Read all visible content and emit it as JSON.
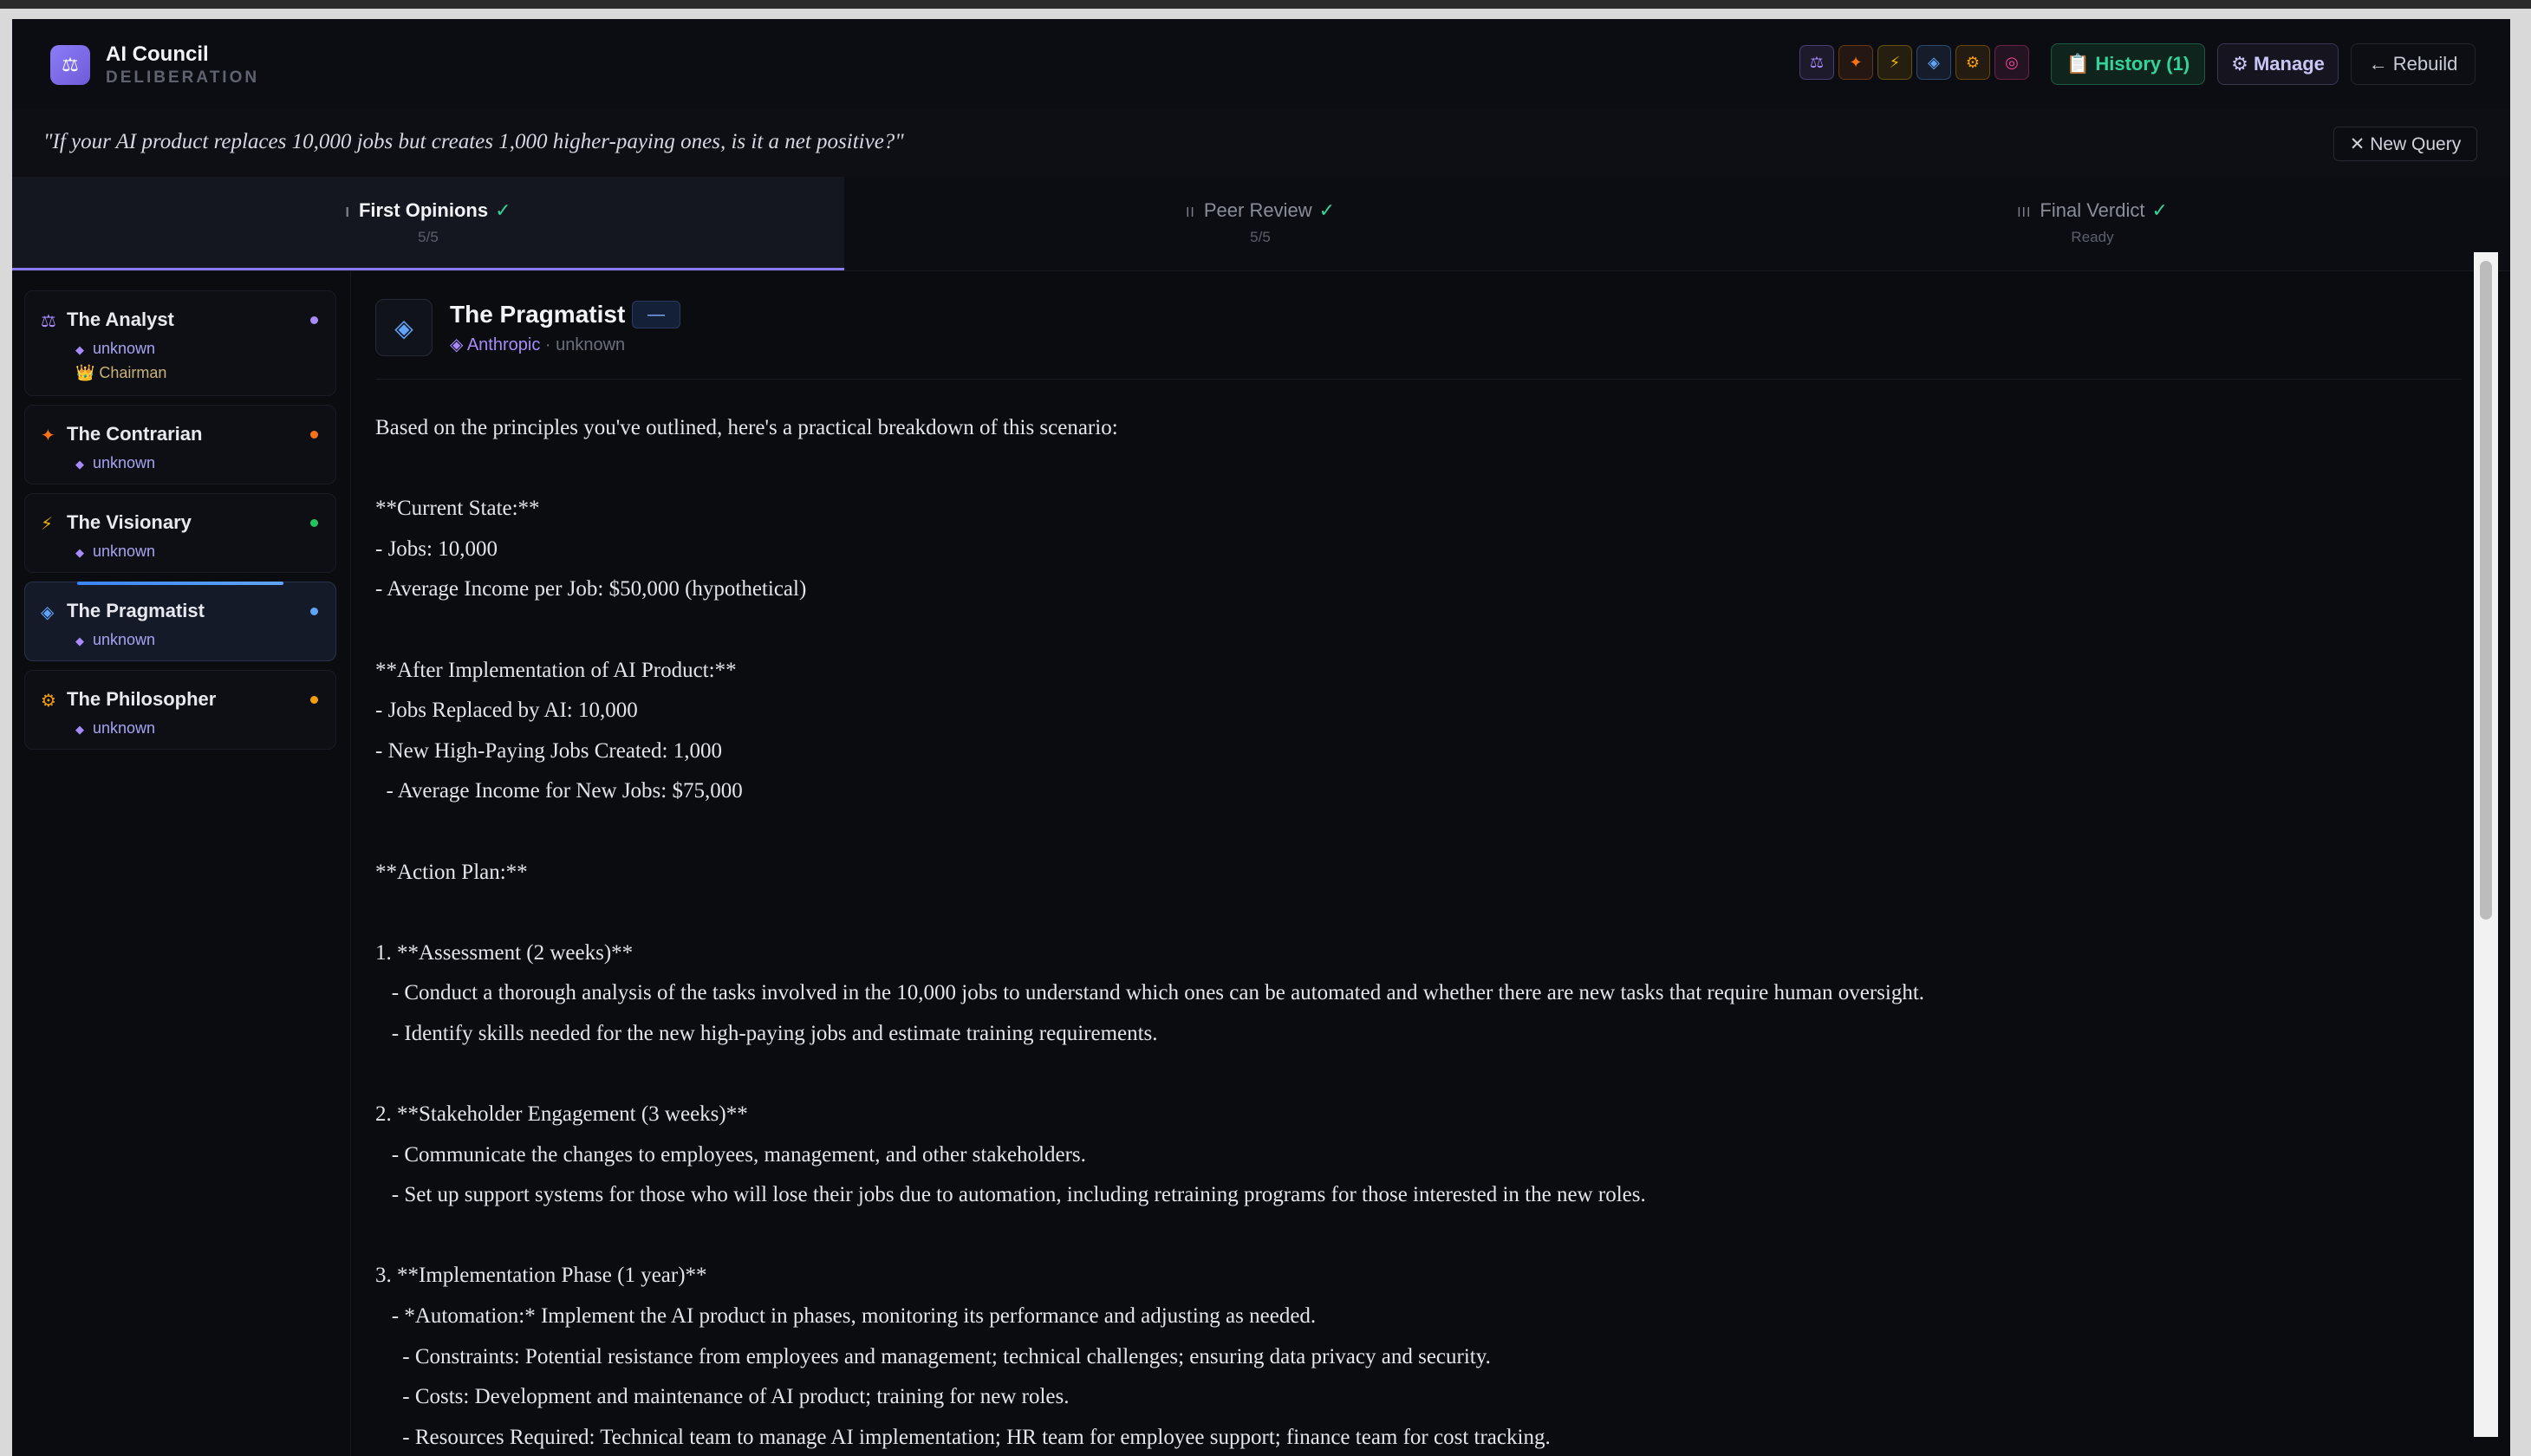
{
  "app": {
    "title": "AI Council",
    "subtitle": "DELIBERATION",
    "logo_icon": "scales-icon"
  },
  "header": {
    "seat_icons": [
      {
        "glyph": "⚖",
        "name": "scales-icon",
        "color": "#a78bfa"
      },
      {
        "glyph": "✦",
        "name": "sparkle-icon",
        "color": "#f97316"
      },
      {
        "glyph": "⚡",
        "name": "bolt-icon",
        "color": "#eab308"
      },
      {
        "glyph": "◈",
        "name": "diamond-icon",
        "color": "#60a5fa"
      },
      {
        "glyph": "⚙",
        "name": "gear-icon",
        "color": "#f59e0b"
      },
      {
        "glyph": "◎",
        "name": "target-icon",
        "color": "#ec4899"
      }
    ],
    "history_label": "📋 History (1)",
    "manage_label": "⚙ Manage",
    "rebuild_label": "← Rebuild"
  },
  "query": {
    "text": "\"If your AI product replaces 10,000 jobs but creates 1,000 higher-paying ones, is it a net positive?\"",
    "new_query_label": "✕ New Query"
  },
  "tabs": [
    {
      "numeral": "I",
      "label": "First Opinions",
      "check": "✓",
      "sub": "5/5",
      "active": true
    },
    {
      "numeral": "II",
      "label": "Peer Review",
      "check": "✓",
      "sub": "5/5",
      "active": false
    },
    {
      "numeral": "III",
      "label": "Final Verdict",
      "check": "✓",
      "sub": "Ready",
      "active": false
    }
  ],
  "members": [
    {
      "name": "The Analyst",
      "icon": "⚖",
      "icon_color": "#a78bfa",
      "dot_color": "#a78bfa",
      "model": "unknown",
      "chair": "👑 Chairman"
    },
    {
      "name": "The Contrarian",
      "icon": "✦",
      "icon_color": "#f97316",
      "dot_color": "#f97316",
      "model": "unknown"
    },
    {
      "name": "The Visionary",
      "icon": "⚡",
      "icon_color": "#eab308",
      "dot_color": "#22c55e",
      "model": "unknown"
    },
    {
      "name": "The Pragmatist",
      "icon": "◈",
      "icon_color": "#60a5fa",
      "dot_color": "#60a5fa",
      "model": "unknown",
      "active": true
    },
    {
      "name": "The Philosopher",
      "icon": "⚙",
      "icon_color": "#f59e0b",
      "dot_color": "#f59e0b",
      "model": "unknown"
    }
  ],
  "panel": {
    "name": "The Pragmatist",
    "icon": "◈",
    "badge": "—",
    "provider": "◈ Anthropic",
    "model": " · unknown",
    "lines": [
      "Based on the principles you've outlined, here's a practical breakdown of this scenario:",
      "",
      "**Current State:**",
      "- Jobs: 10,000",
      "- Average Income per Job: $50,000 (hypothetical)",
      "",
      "**After Implementation of AI Product:**",
      "- Jobs Replaced by AI: 10,000",
      "- New High-Paying Jobs Created: 1,000",
      "  - Average Income for New Jobs: $75,000",
      "",
      "**Action Plan:**",
      "",
      "1. **Assessment (2 weeks)**",
      "   - Conduct a thorough analysis of the tasks involved in the 10,000 jobs to understand which ones can be automated and whether there are new tasks that require human oversight.",
      "   - Identify skills needed for the new high-paying jobs and estimate training requirements.",
      "",
      "2. **Stakeholder Engagement (3 weeks)**",
      "   - Communicate the changes to employees, management, and other stakeholders.",
      "   - Set up support systems for those who will lose their jobs due to automation, including retraining programs for those interested in the new roles.",
      "",
      "3. **Implementation Phase (1 year)**",
      "   - *Automation:* Implement the AI product in phases, monitoring its performance and adjusting as needed.",
      "     - Constraints: Potential resistance from employees and management; technical challenges; ensuring data privacy and security.",
      "     - Costs: Development and maintenance of AI product; training for new roles.",
      "     - Resources Required: Technical team to manage AI implementation; HR team for employee support; finance team for cost tracking."
    ]
  }
}
